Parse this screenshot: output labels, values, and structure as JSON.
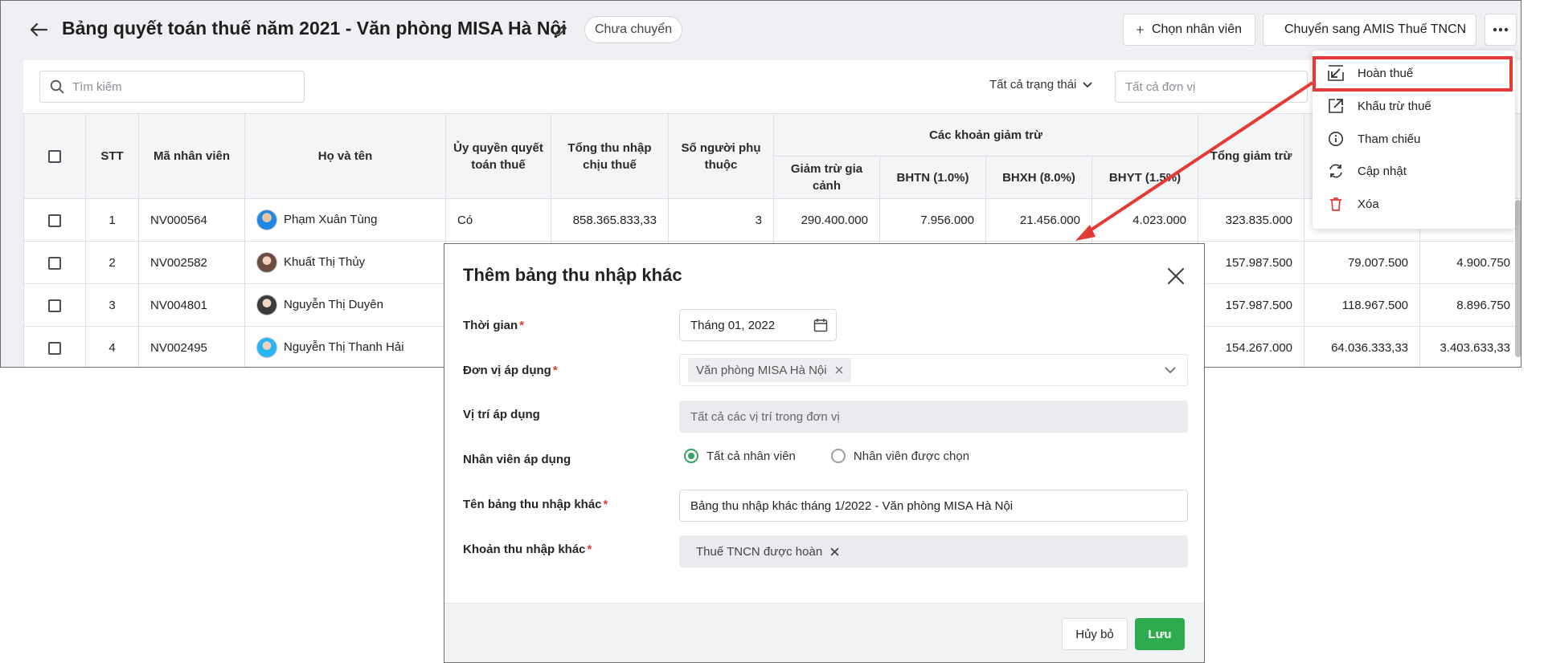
{
  "header": {
    "title": "Bảng quyết toán thuế năm 2021 - Văn phòng MISA Hà Nội",
    "status": "Chưa chuyển",
    "choose_employee_label": "Chọn nhân viên",
    "transfer_label": "Chuyển sang AMIS Thuế TNCN"
  },
  "toolbar": {
    "search_placeholder": "Tìm kiếm",
    "status_filter": "Tất cả trạng thái",
    "unit_filter_placeholder": "Tất cả đơn vị"
  },
  "table": {
    "headers": {
      "stt": "STT",
      "employee_code": "Mã nhân viên",
      "full_name": "Họ và tên",
      "authorization": "Ủy quyền quyết toán thuế",
      "total_taxable_income": "Tổng thu nhập chịu thuế",
      "dependents": "Số người phụ thuộc",
      "deductions_group": "Các khoản giảm trừ",
      "family_deduction": "Giảm trừ gia cảnh",
      "bhtn": "BHTN (1.0%)",
      "bhxh": "BHXH (8.0%)",
      "bhyt": "BHYT (1.5%)",
      "total_deduction": "Tổng giảm trừ"
    },
    "rows": [
      {
        "stt": "1",
        "code": "NV000564",
        "name": "Phạm Xuân Tùng",
        "auth": "Có",
        "income": "858.365.833,33",
        "dependents": "3",
        "family": "290.400.000",
        "bhtn": "7.956.000",
        "bhxh": "21.456.000",
        "bhyt": "4.023.000",
        "total": "323.835.000",
        "c12": "",
        "c13": ""
      },
      {
        "stt": "2",
        "code": "NV002582",
        "name": "Khuất Thị Thủy",
        "auth": "",
        "income": "",
        "dependents": "",
        "family": "",
        "bhtn": "",
        "bhxh": "",
        "bhyt": "",
        "total": "157.987.500",
        "c12": "79.007.500",
        "c13": "4.900.750"
      },
      {
        "stt": "3",
        "code": "NV004801",
        "name": "Nguyễn Thị Duyên",
        "auth": "",
        "income": "",
        "dependents": "",
        "family": "",
        "bhtn": "",
        "bhxh": "",
        "bhyt": "",
        "total": "157.987.500",
        "c12": "118.967.500",
        "c13": "8.896.750"
      },
      {
        "stt": "4",
        "code": "NV002495",
        "name": "Nguyễn Thị Thanh Hải",
        "auth": "",
        "income": "",
        "dependents": "",
        "family": "",
        "bhtn": "",
        "bhxh": "",
        "bhyt": "",
        "total": "154.267.000",
        "c12": "64.036.333,33",
        "c13": "3.403.633,33"
      }
    ]
  },
  "menu": {
    "items": [
      {
        "label": "Hoàn thuế",
        "icon": "arrow-down-left-icon"
      },
      {
        "label": "Khấu trừ thuế",
        "icon": "arrow-up-right-icon"
      },
      {
        "label": "Tham chiếu",
        "icon": "info-icon"
      },
      {
        "label": "Cập nhật",
        "icon": "refresh-icon"
      },
      {
        "label": "Xóa",
        "icon": "trash-icon"
      }
    ],
    "highlighted": "Hoàn thuế"
  },
  "dialog": {
    "title": "Thêm bảng thu nhập khác",
    "time_label": "Thời gian",
    "time_value": "Tháng 01, 2022",
    "unit_label": "Đơn vị áp dụng",
    "unit_tag": "Văn phòng MISA Hà Nội",
    "position_label": "Vị trí áp dụng",
    "position_value": "Tất cả các vị trí trong đơn vị",
    "employee_label": "Nhân viên áp dụng",
    "radio_all": "Tất cả nhân viên",
    "radio_selected": "Nhân viên được chọn",
    "name_label": "Tên bảng thu nhập khác",
    "name_value": "Bảng thu nhập khác tháng 1/2022 - Văn phòng MISA Hà Nội",
    "income_label": "Khoản thu nhập khác",
    "income_tag": "Thuế TNCN được hoàn",
    "cancel_label": "Hủy bỏ",
    "save_label": "Lưu"
  },
  "colors": {
    "accent_green": "#2eaa4f",
    "highlight_red": "#e53935",
    "delete_red": "#e53935"
  }
}
